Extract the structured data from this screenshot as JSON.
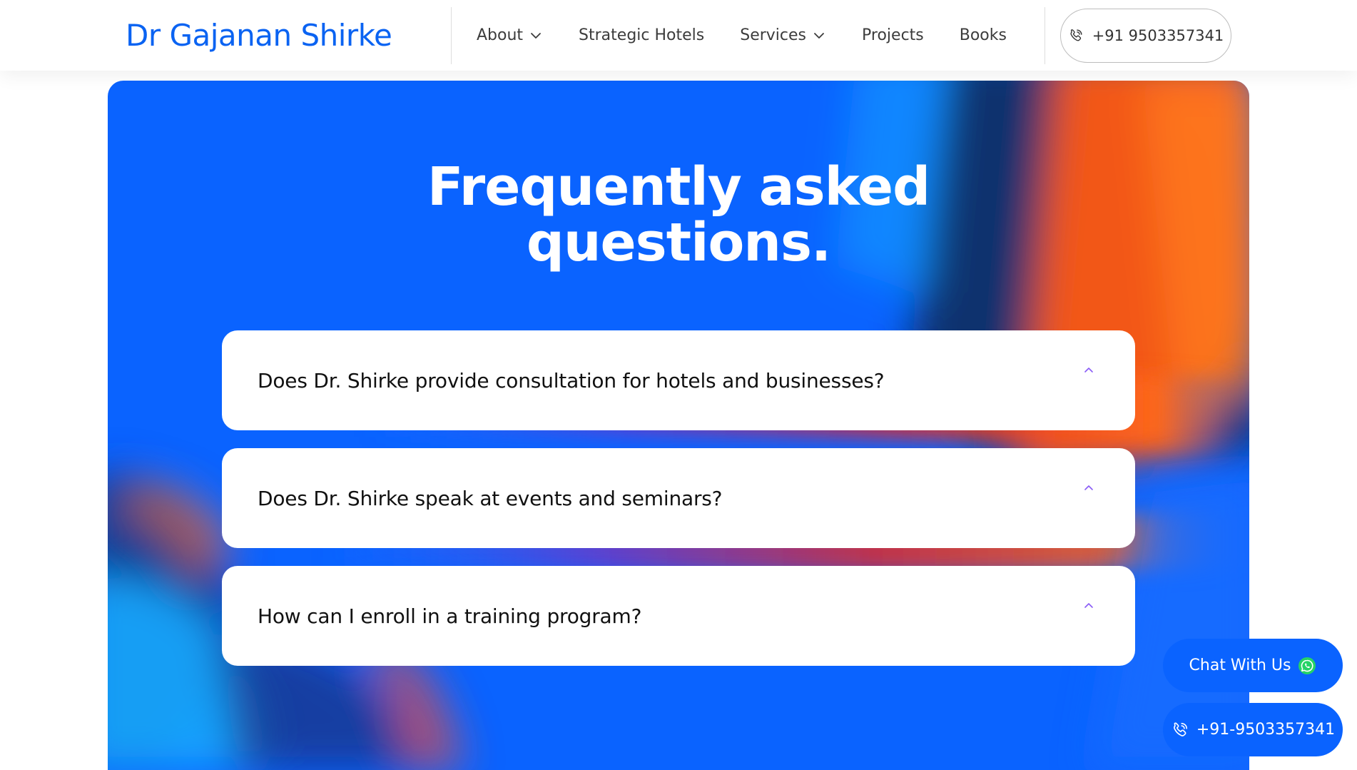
{
  "header": {
    "logo": "Dr Gajanan Shirke",
    "nav": [
      {
        "label": "About",
        "has_dropdown": true
      },
      {
        "label": "Strategic Hotels",
        "has_dropdown": false
      },
      {
        "label": "Services",
        "has_dropdown": true
      },
      {
        "label": "Projects",
        "has_dropdown": false
      },
      {
        "label": "Books",
        "has_dropdown": false
      }
    ],
    "phone": "+91 9503357341"
  },
  "faq": {
    "title_line1": "Frequently asked",
    "title_line2": "questions.",
    "items": [
      {
        "question": "Does Dr. Shirke provide consultation for hotels and businesses?"
      },
      {
        "question": "Does Dr. Shirke speak at events and seminars?"
      },
      {
        "question": "How can I enroll in a training program?"
      }
    ]
  },
  "floating": {
    "chat_label": "Chat With Us",
    "call_label": "+91-9503357341"
  },
  "colors": {
    "brand": "#0a63f2",
    "panel": "#0a63ff",
    "caret": "#8a5cf6"
  }
}
